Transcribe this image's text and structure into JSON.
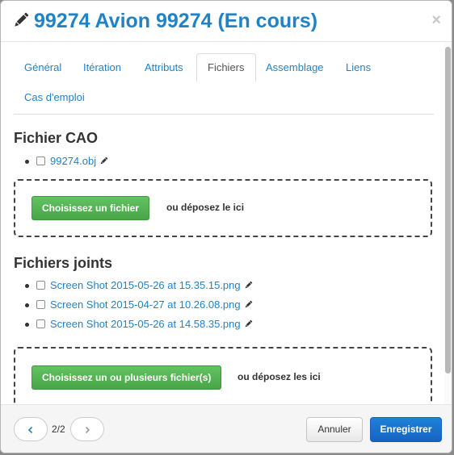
{
  "modal": {
    "title": "99274 Avion 99274 (En cours)",
    "close_glyph": "×"
  },
  "tabs": [
    {
      "label": "Général"
    },
    {
      "label": "Itération"
    },
    {
      "label": "Attributs"
    },
    {
      "label": "Fichiers",
      "active": true
    },
    {
      "label": "Assemblage"
    },
    {
      "label": "Liens"
    },
    {
      "label": "Cas d'emploi"
    }
  ],
  "cad": {
    "title": "Fichier CAO",
    "files": [
      "99274.obj"
    ],
    "choose_button": "Choisissez un fichier",
    "drop_text": "ou déposez le ici"
  },
  "attached": {
    "title": "Fichiers joints",
    "files": [
      "Screen Shot 2015-05-26 at 15.35.15.png",
      "Screen Shot 2015-04-27 at 10.26.08.png",
      "Screen Shot 2015-05-26 at 14.58.35.png"
    ],
    "choose_button": "Choisissez un ou plusieurs fichier(s)",
    "drop_text": "ou déposez les ici"
  },
  "footer": {
    "pager": "2/2",
    "cancel_label": "Annuler",
    "save_label": "Enregistrer"
  },
  "icons": {
    "title": "pencil-icon",
    "edit": "pencil-icon",
    "prev": "chevron-left-icon",
    "next": "chevron-right-icon",
    "close": "close-icon"
  },
  "colors": {
    "link": "#2183c7",
    "success": "#5cb85c",
    "primary": "#1a6fc9"
  }
}
